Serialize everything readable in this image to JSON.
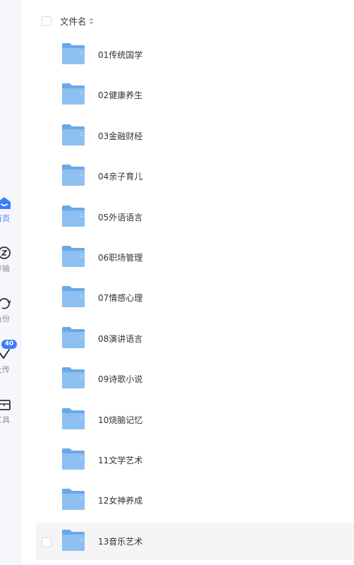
{
  "header": {
    "column_title": "文件名"
  },
  "nav": {
    "items": [
      {
        "label": "首页",
        "icon": "home-face-icon",
        "active": true
      },
      {
        "label": "传输",
        "icon": "transfer-icon",
        "active": false
      },
      {
        "label": "备份",
        "icon": "backup-icon",
        "active": false
      },
      {
        "label": "上传",
        "icon": "upload-check-icon",
        "active": false,
        "badge": "40"
      },
      {
        "label": "工具",
        "icon": "toolbox-icon",
        "active": false
      }
    ]
  },
  "files": [
    {
      "name": "01传统国学"
    },
    {
      "name": "02健康养生"
    },
    {
      "name": "03金融财经"
    },
    {
      "name": "04亲子育儿"
    },
    {
      "name": "05外语语言"
    },
    {
      "name": "06职场管理"
    },
    {
      "name": "07情感心理"
    },
    {
      "name": "08演讲语言"
    },
    {
      "name": "09诗歌小说"
    },
    {
      "name": "10烧脑记忆"
    },
    {
      "name": "11文学艺术"
    },
    {
      "name": "12女神养成"
    },
    {
      "name": "13音乐艺术"
    }
  ],
  "colors": {
    "accent": "#3b7cff",
    "folder": "#7fb6ec",
    "hover_row": "#f5f5f6",
    "nav_bg": "#f6f7fb"
  }
}
